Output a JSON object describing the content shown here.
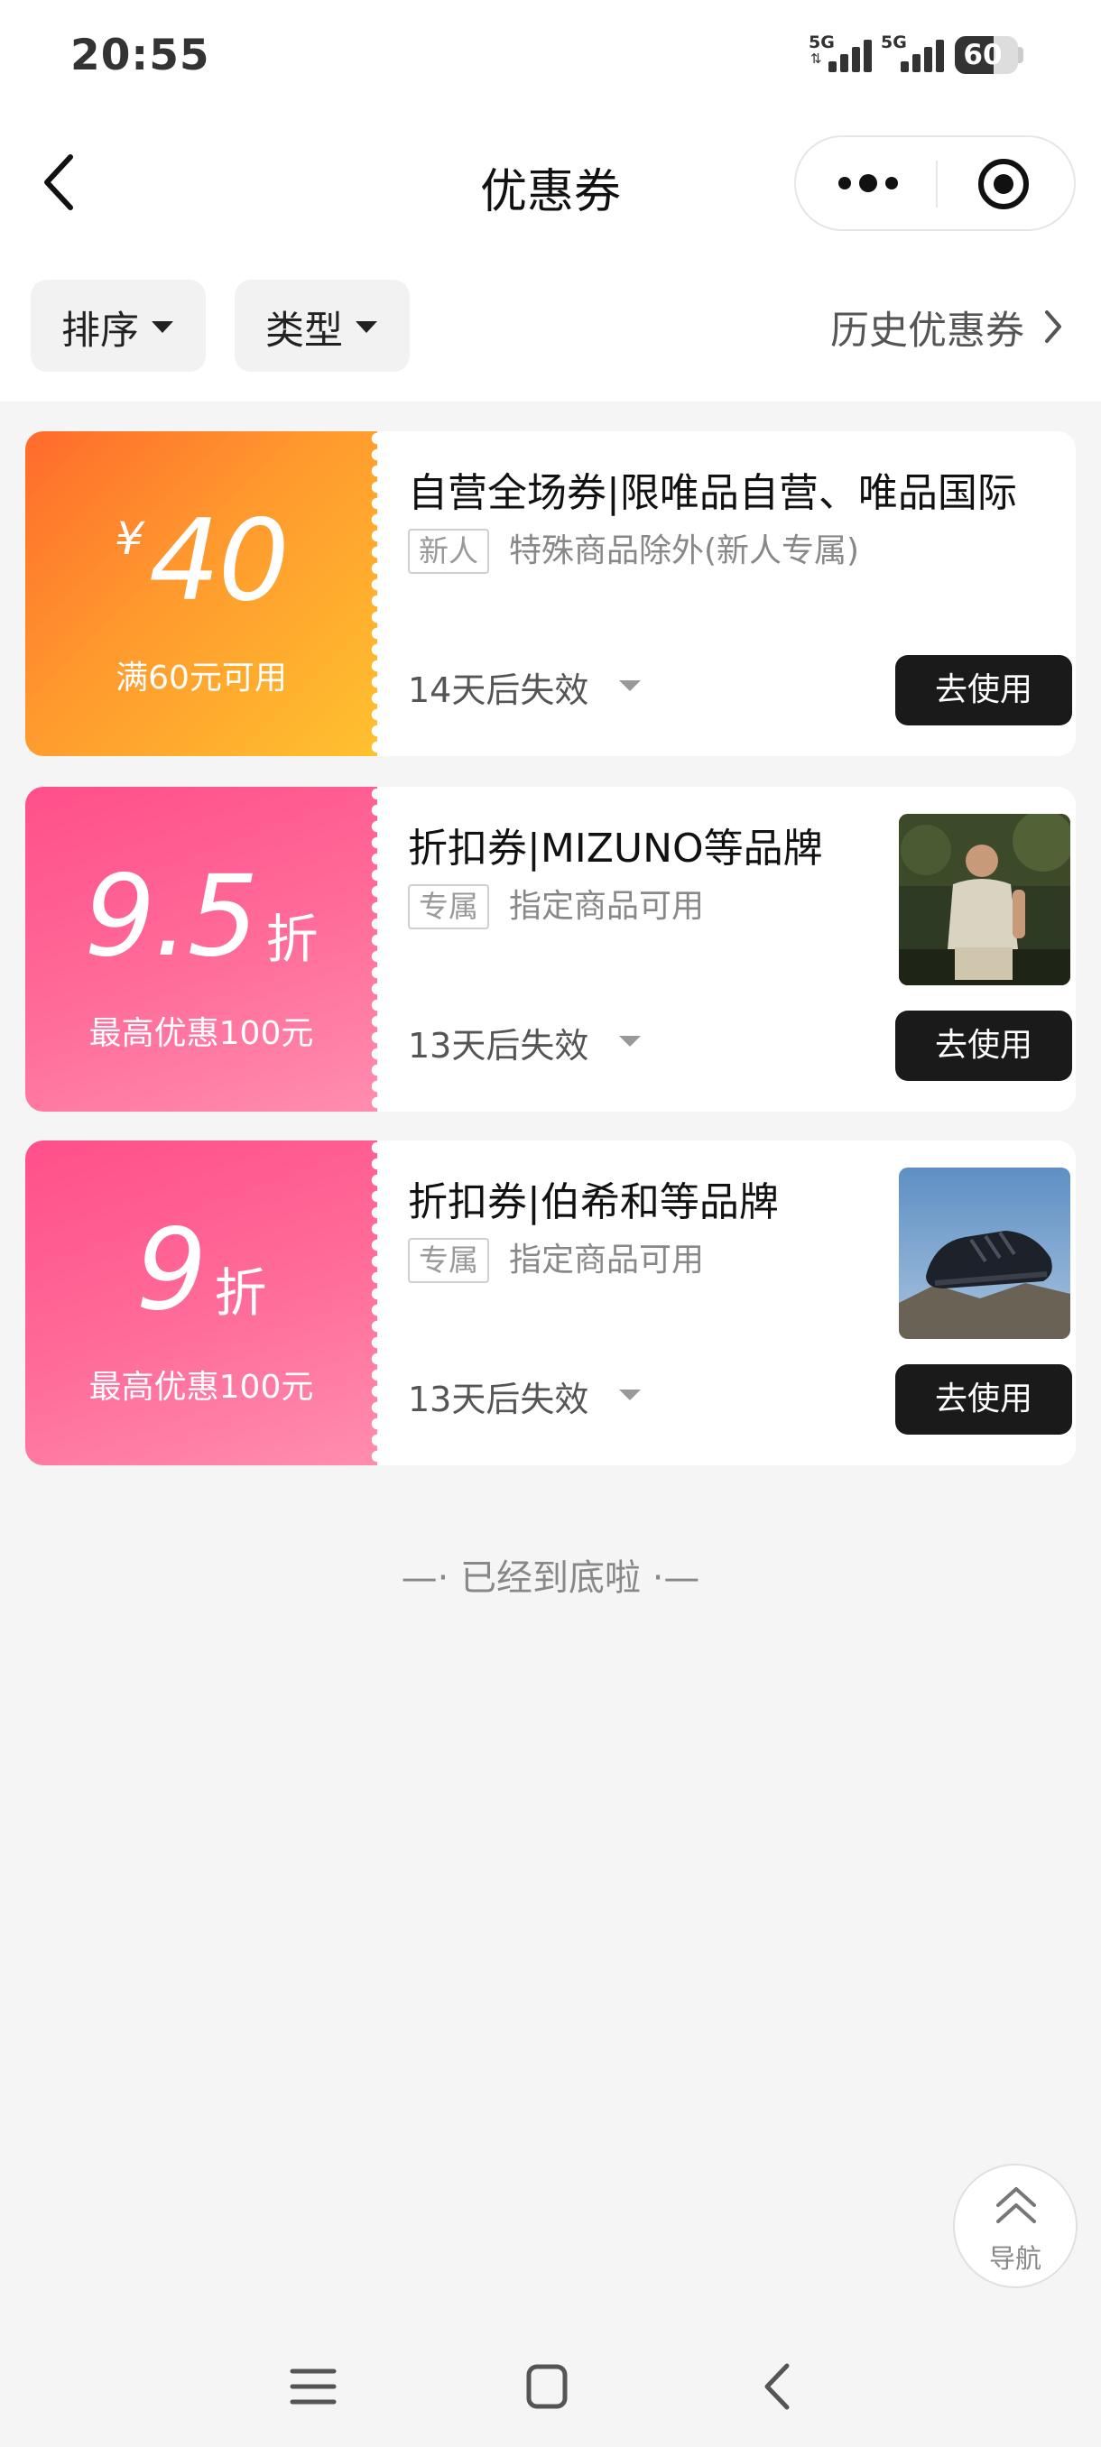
{
  "status_bar": {
    "time": "20:55",
    "signal1_label": "5G",
    "signal2_label": "5G",
    "battery": "60",
    "battery_level": 0.6
  },
  "header": {
    "title": "优惠券",
    "back_icon": "chevron-left-icon",
    "more_icon": "more-dots-icon",
    "close_icon": "target-icon"
  },
  "filters": {
    "sort_label": "排序",
    "type_label": "类型",
    "history_label": "历史优惠券"
  },
  "coupons": [
    {
      "currency": "¥",
      "amount": "40",
      "unit": "",
      "condition": "满60元可用",
      "title": "自营全场券|限唯品自营、唯品国际",
      "tag": "新人",
      "tag_desc": "特殊商品除外(新人专属)",
      "expire": "14天后失效",
      "button": "去使用",
      "stub_color": "#ff7a2c"
    },
    {
      "currency": "",
      "amount": "9.5",
      "unit": "折",
      "condition": "最高优惠100元",
      "title": "折扣券|MIZUNO等品牌",
      "tag": "专属",
      "tag_desc": "指定商品可用",
      "expire": "13天后失效",
      "button": "去使用",
      "stub_color": "#ff5a90"
    },
    {
      "currency": "",
      "amount": "9",
      "unit": "折",
      "condition": "最高优惠100元",
      "title": "折扣券|伯希和等品牌",
      "tag": "专属",
      "tag_desc": "指定商品可用",
      "expire": "13天后失效",
      "button": "去使用",
      "stub_color": "#ff5a90"
    }
  ],
  "footer": {
    "end_text": "—· 已经到底啦 ·—"
  },
  "float_nav": {
    "label": "导航",
    "icon": "double-chevron-up-icon"
  },
  "system_nav": {
    "menu_icon": "menu-icon",
    "home_icon": "square-home-icon",
    "back_icon": "back-triangle-icon"
  }
}
